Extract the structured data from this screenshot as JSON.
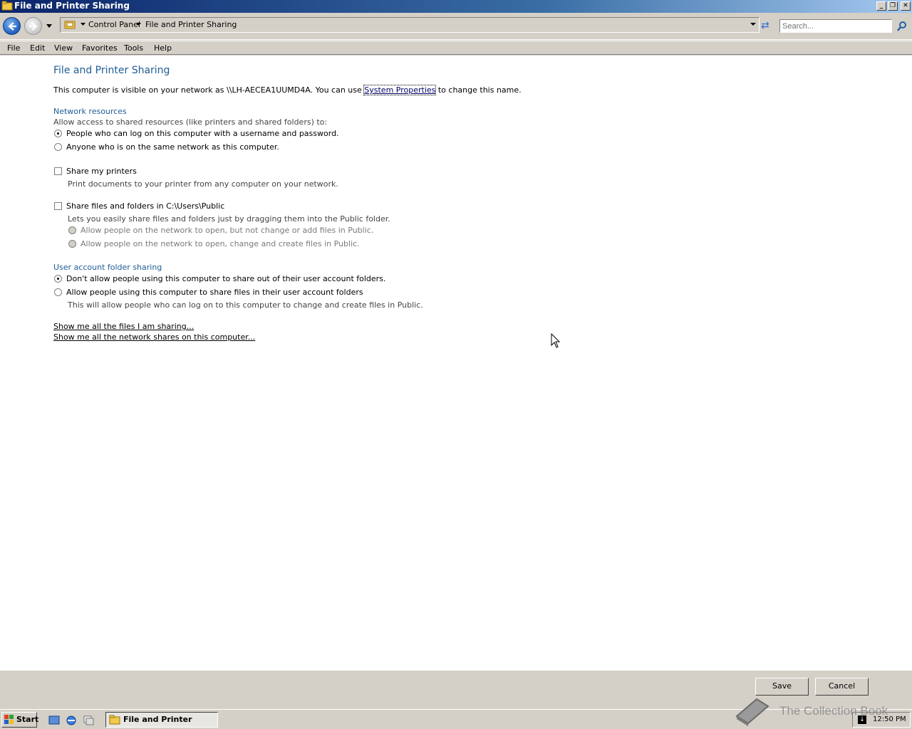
{
  "window": {
    "title": "File and Printer Sharing",
    "controls": {
      "minimize": "_",
      "restore": "❐",
      "close": "✕"
    }
  },
  "navbar": {
    "breadcrumb": [
      "Control Panel",
      "File and Printer Sharing"
    ],
    "search_placeholder": "Search..."
  },
  "menu": [
    "File",
    "Edit",
    "View",
    "Favorites",
    "Tools",
    "Help"
  ],
  "content": {
    "page_title": "File and Printer Sharing",
    "visibility_prefix": "This computer is visible on your network as \\\\LH-AECEA1UUMD4A.  You can use ",
    "system_properties_link": "System Properties",
    "visibility_suffix": " to change this name.",
    "network_resources": {
      "heading": "Network resources",
      "intro": "Allow access to shared resources (like printers and shared folders) to:",
      "option_password": "People who can log on this computer with a username and password.",
      "option_anyone": "Anyone who is on the same network as this computer.",
      "selected": "password"
    },
    "printers": {
      "label": "Share my printers",
      "description": "Print documents to your printer from any computer on your network.",
      "checked": false
    },
    "public_folder": {
      "label": "Share files and folders in C:\\Users\\Public",
      "description": "Lets you easily share files and folders just by dragging them into the Public folder.",
      "option_read": "Allow people on the network to open, but not change or add files in Public.",
      "option_change": "Allow people on the network to open, change and create files in Public.",
      "checked": false
    },
    "user_folder_sharing": {
      "heading": "User account folder sharing",
      "option_dont_allow": "Don't allow people using this computer to share out of their user account folders.",
      "option_allow": "Allow people using this computer to share files in their user account folders",
      "allow_description": "This will allow people who can log on to this computer to change and create files in Public.",
      "selected": "dont_allow"
    },
    "links": {
      "files_sharing": "Show me all the files I am sharing...",
      "network_shares": "Show me all the network shares on this computer..."
    }
  },
  "footer": {
    "save": "Save",
    "cancel": "Cancel"
  },
  "taskbar": {
    "start": "Start",
    "task_label": "File and Printer Shari...",
    "clock": "12:50 PM"
  },
  "watermark": "The Collection Book",
  "colors": {
    "accent": "#1e5d96",
    "titlebar": "#0a246a",
    "face": "#d4d0c8"
  }
}
